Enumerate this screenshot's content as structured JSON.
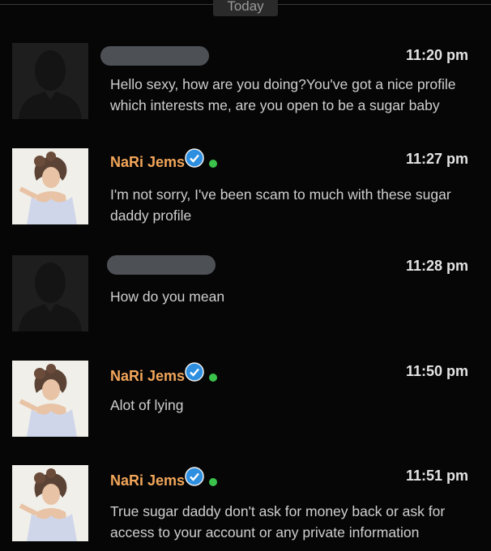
{
  "divider": {
    "label": "Today"
  },
  "messages": [
    {
      "sender": "",
      "sender_redacted": true,
      "verified": false,
      "online": false,
      "time": "11:20 pm",
      "text": "Hello sexy, how are you doing?You've got a nice profile which interests me, are you open to be a sugar baby",
      "avatar": "default-silhouette"
    },
    {
      "sender": "NaRi Jems",
      "sender_redacted": false,
      "verified": true,
      "online": true,
      "time": "11:27 pm",
      "text": "I'm not sorry, I've been scam to much with these sugar daddy profile",
      "avatar": "illustrated-portrait"
    },
    {
      "sender": "",
      "sender_redacted": true,
      "verified": false,
      "online": false,
      "time": "11:28 pm",
      "text": "How do you mean",
      "avatar": "default-silhouette"
    },
    {
      "sender": "NaRi Jems",
      "sender_redacted": false,
      "verified": true,
      "online": true,
      "time": "11:50 pm",
      "text": "Alot of lying",
      "avatar": "illustrated-portrait"
    },
    {
      "sender": "NaRi Jems",
      "sender_redacted": false,
      "verified": true,
      "online": true,
      "time": "11:51 pm",
      "text": "True sugar daddy don't ask for money back or ask for access to your account or any private information",
      "avatar": "illustrated-portrait"
    }
  ],
  "colors": {
    "background": "#060606",
    "name": "#f2a65a",
    "verified_badge": "#2e8fe0",
    "online_dot": "#3bc24a",
    "redacted_bar": "#4d5156"
  }
}
